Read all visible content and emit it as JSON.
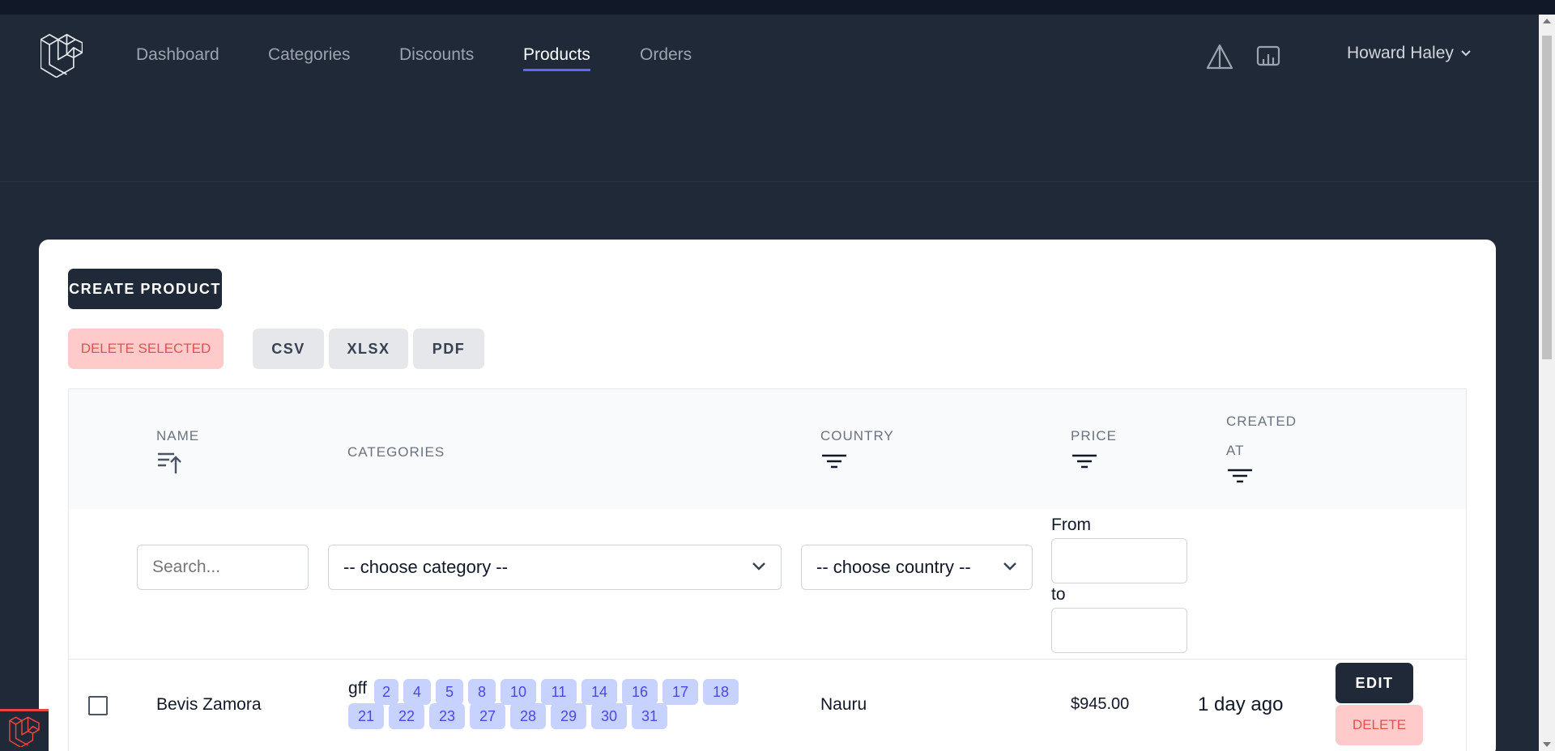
{
  "nav": {
    "links": [
      {
        "label": "Dashboard",
        "active": false
      },
      {
        "label": "Categories",
        "active": false
      },
      {
        "label": "Discounts",
        "active": false
      },
      {
        "label": "Products",
        "active": true
      },
      {
        "label": "Orders",
        "active": false
      }
    ],
    "icons": [
      "warning-triangle-icon",
      "dashboard-monitor-icon"
    ],
    "user_name": "Howard Haley"
  },
  "toolbar": {
    "create_label": "CREATE PRODUCT",
    "delete_selected_label": "DELETE SELECTED",
    "export_buttons": [
      "CSV",
      "XLSX",
      "PDF"
    ]
  },
  "table": {
    "headers": {
      "name": "NAME",
      "categories": "CATEGORIES",
      "country": "COUNTRY",
      "price": "PRICE",
      "created_line1": "CREATED",
      "created_line2": "AT"
    },
    "filters": {
      "search_placeholder": "Search...",
      "category_selected": "-- choose category --",
      "country_selected": "-- choose country --",
      "price_from_label": "From",
      "price_to_label": "to"
    },
    "rows": [
      {
        "name": "Bevis Zamora",
        "categories_first": "gff",
        "categories": [
          "2",
          "4",
          "5",
          "8",
          "10",
          "11",
          "14",
          "16",
          "17",
          "18",
          "21",
          "22",
          "23",
          "27",
          "28",
          "29",
          "30",
          "31"
        ],
        "country": "Nauru",
        "price": "$945.00",
        "created": "1 day ago",
        "edit_label": "EDIT",
        "delete_label": "DELETE"
      }
    ]
  },
  "colors": {
    "nav_bg": "#1f2937",
    "active_underline": "#6366f1",
    "primary_button": "#1f2937",
    "danger_bg": "#fecaca",
    "danger_text": "#e05252",
    "tag_bg": "#c7d2fe",
    "tag_text": "#4f46e5"
  }
}
